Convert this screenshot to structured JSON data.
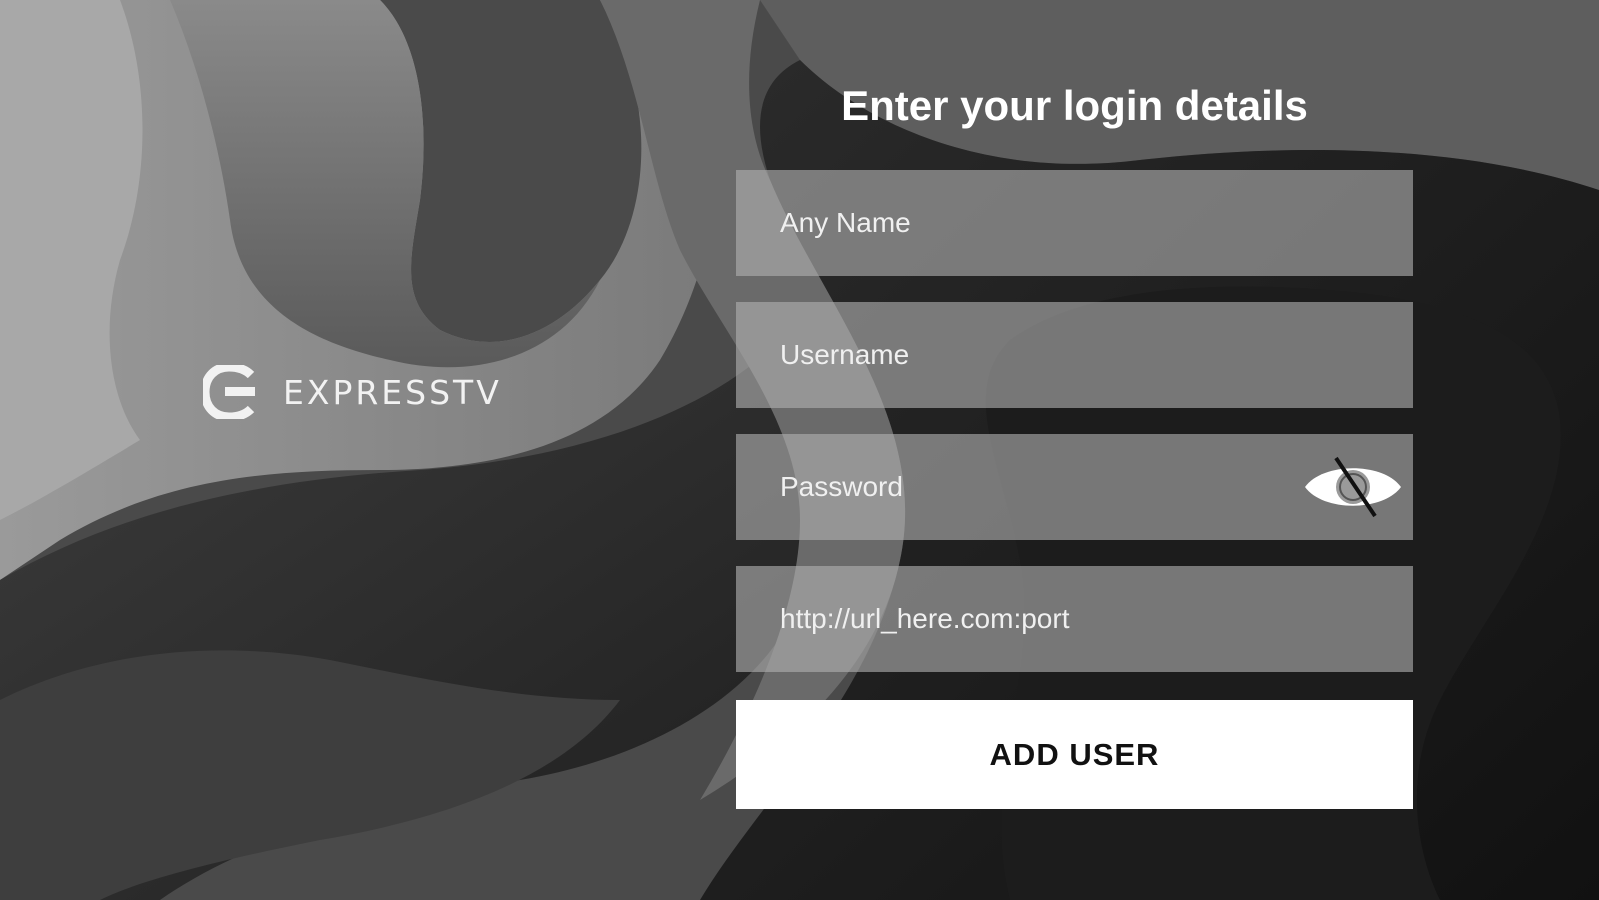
{
  "brand": {
    "name": "EXPRESSTV",
    "logo_icon": "expresstv-e-logo"
  },
  "login": {
    "title": "Enter your login details",
    "fields": [
      {
        "id": "any-name",
        "placeholder": "Any Name",
        "value": ""
      },
      {
        "id": "username",
        "placeholder": "Username",
        "value": ""
      },
      {
        "id": "password",
        "placeholder": "Password",
        "value": ""
      },
      {
        "id": "server-url",
        "placeholder": "http://url_here.com:port",
        "value": ""
      }
    ],
    "password_toggle_icon": "eye-slash-icon",
    "submit_label": "ADD USER"
  },
  "colors": {
    "button_bg": "#ffffff",
    "button_text": "#111111",
    "field_bg": "#b0b0b0",
    "title_text": "#ffffff"
  }
}
